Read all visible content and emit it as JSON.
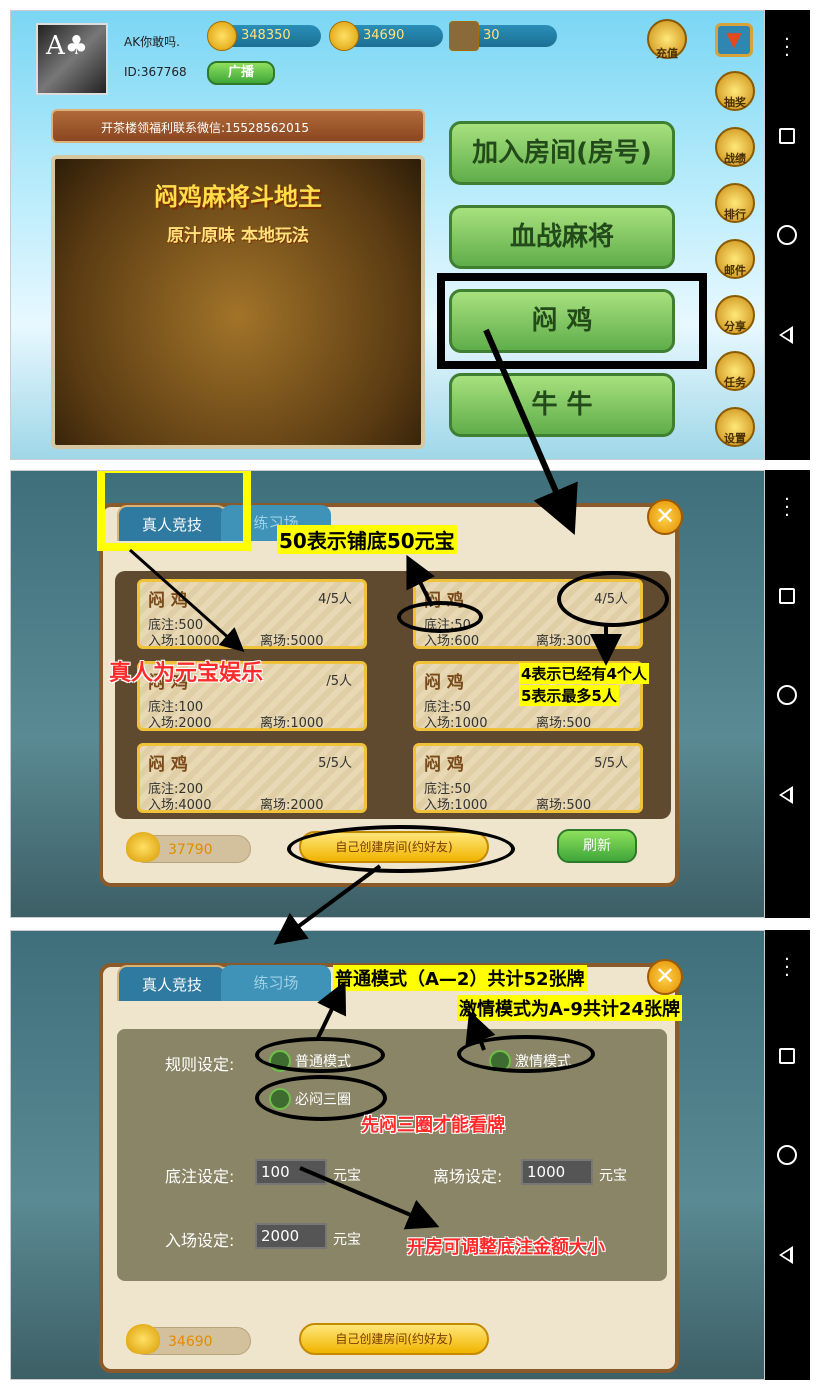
{
  "user": {
    "name": "AK你敢吗.",
    "id": "ID:367768",
    "broadcast": "广播"
  },
  "currency": {
    "gold": "348350",
    "ingot": "34690",
    "tickets": "30",
    "recharge": "充值"
  },
  "ticker": "开茶楼领福利联系微信:15528562015",
  "banner": {
    "title": "闷鸡麻将斗地主",
    "subtitle": "原汁原味 本地玩法"
  },
  "menu": [
    {
      "label": "加入房间(房号)"
    },
    {
      "label": "血战麻将"
    },
    {
      "label": "闷 鸡"
    },
    {
      "label": "牛 牛"
    }
  ],
  "side": [
    "抽奖",
    "战绩",
    "排行",
    "邮件",
    "分享",
    "任务",
    "设置"
  ],
  "lobby": {
    "tabs": [
      "真人竞技",
      "练习场"
    ],
    "rooms": [
      {
        "title": "闷 鸡",
        "count": "4/5人",
        "base": "底注:500",
        "enter": "入场:10000",
        "leave": "离场:5000"
      },
      {
        "title": "闷 鸡",
        "count": "4/5人",
        "base": "底注:50",
        "enter": "入场:600",
        "leave": "离场:300"
      },
      {
        "title": "闷 鸡",
        "count": "/5人",
        "base": "底注:100",
        "enter": "入场:2000",
        "leave": "离场:1000"
      },
      {
        "title": "闷 鸡",
        "count": "",
        "base": "底注:50",
        "enter": "入场:1000",
        "leave": "离场:500"
      },
      {
        "title": "闷 鸡",
        "count": "5/5人",
        "base": "底注:200",
        "enter": "入场:4000",
        "leave": "离场:2000"
      },
      {
        "title": "闷 鸡",
        "count": "5/5人",
        "base": "底注:50",
        "enter": "入场:1000",
        "leave": "离场:500"
      }
    ],
    "coins": "37790",
    "create": "自己创建房间(约好友)",
    "refresh": "刷新"
  },
  "create_room": {
    "tabs": [
      "真人竞技",
      "练习场"
    ],
    "rule_label": "规则设定:",
    "mode_normal": "普通模式",
    "mode_fast": "激情模式",
    "must_three": "必闷三圈",
    "base_label": "底注设定:",
    "base_value": "100",
    "leave_label": "离场设定:",
    "leave_value": "1000",
    "enter_label": "入场设定:",
    "enter_value": "2000",
    "unit": "元宝",
    "coins": "34690",
    "create": "自己创建房间(约好友)"
  },
  "annotations": {
    "n1": "50表示铺底50元宝",
    "n2": "真人为元宝娱乐",
    "n3a": "4表示已经有4个人",
    "n3b": "5表示最多5人",
    "n4": "普通模式（A—2）共计52张牌",
    "n5": "激情模式为A-9共计24张牌",
    "n6": "先闷三圈才能看牌",
    "n7": "开房可调整底注金额大小"
  },
  "colors": {
    "accent": "#3fa63a",
    "annotation_red": "#ff2a2a",
    "annotation_yellow": "#ffff00"
  }
}
